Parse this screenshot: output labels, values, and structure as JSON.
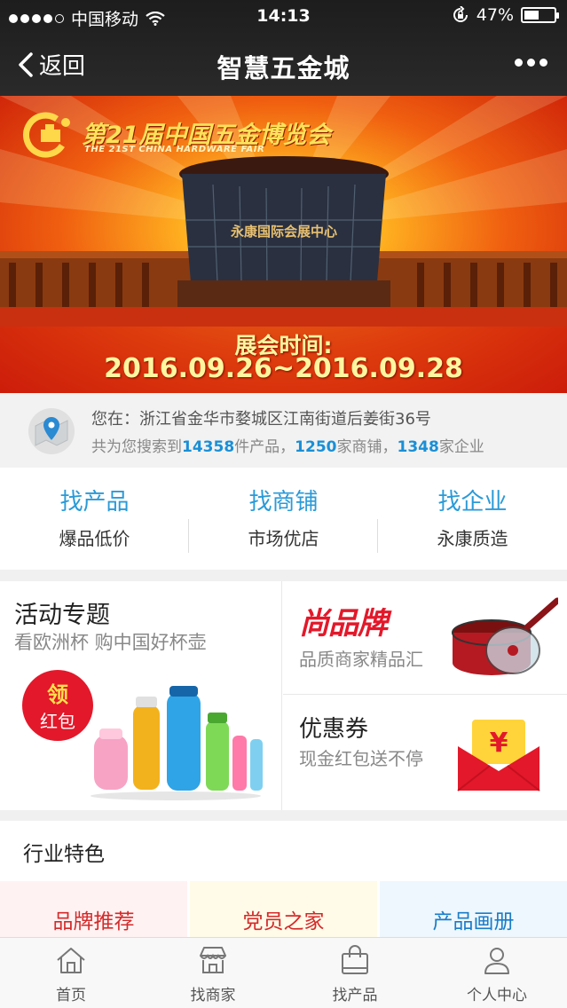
{
  "status": {
    "carrier": "中国移动",
    "time": "14:13",
    "battery": "47%"
  },
  "nav": {
    "back_label": "返回",
    "title": "智慧五金城"
  },
  "banner": {
    "fair_title": "第21届中国五金博览会",
    "fair_subtitle": "THE 21ST CHINA HARDWARE FAIR",
    "building_sign": "永康国际会展中心",
    "expo_label": "展会时间:",
    "expo_date": "2016.09.26~2016.09.28"
  },
  "location": {
    "address": "您在：浙江省金华市婺城区江南街道后姜街36号",
    "stats_prefix": "共为您搜索到",
    "products": "14358",
    "products_suffix": "件产品，",
    "shops": "1250",
    "shops_suffix": "家商铺，",
    "companies": "1348",
    "companies_suffix": "家企业"
  },
  "find": [
    {
      "title": "找产品",
      "sub": "爆品低价"
    },
    {
      "title": "找商铺",
      "sub": "市场优店"
    },
    {
      "title": "找企业",
      "sub": "永康质造"
    }
  ],
  "promo": {
    "activity_title": "活动专题",
    "activity_sub": "看欧洲杯 购中国好杯壶",
    "redpack_a": "领",
    "redpack_b": "红包",
    "brand_logo": "尚品牌",
    "brand_sub": "品质商家精品汇",
    "coupon_title": "优惠券",
    "coupon_sub": "现金红包送不停"
  },
  "industry": {
    "title": "行业特色",
    "tiles": [
      {
        "label": "品牌推荐",
        "color": "#d42a2a",
        "bg": "#fff2f2"
      },
      {
        "label": "党员之家",
        "color": "#d42a2a",
        "bg": "#fffbe8"
      },
      {
        "label": "产品画册",
        "color": "#1a7cc8",
        "bg": "#eef7fd"
      }
    ]
  },
  "tabs": [
    {
      "label": "首页",
      "icon": "home-icon"
    },
    {
      "label": "找商家",
      "icon": "store-icon"
    },
    {
      "label": "找产品",
      "icon": "bag-icon"
    },
    {
      "label": "个人中心",
      "icon": "person-icon"
    }
  ],
  "colors": {
    "accent": "#2a9ad8",
    "red": "#e3182a"
  }
}
